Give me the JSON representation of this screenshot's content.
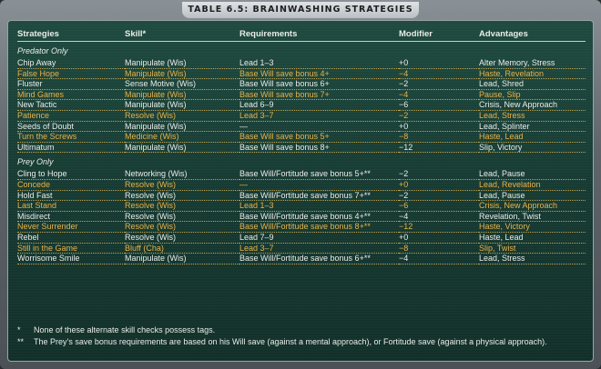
{
  "title": "TABLE 6.5: BRAINWASHING STRATEGIES",
  "headers": [
    "Strategies",
    "Skill*",
    "Requirements",
    "Modifier",
    "Advantages"
  ],
  "sections": [
    {
      "label": "Predator Only",
      "rows": [
        {
          "strategy": "Chip Away",
          "skill": "Manipulate (Wis)",
          "requirements": "Lead 1–3",
          "modifier": "+0",
          "advantages": "Alter Memory, Stress",
          "alt": false
        },
        {
          "strategy": "False Hope",
          "skill": "Manipulate (Wis)",
          "requirements": "Base Will save bonus 4+",
          "modifier": "−4",
          "advantages": "Haste, Revelation",
          "alt": true
        },
        {
          "strategy": "Fluster",
          "skill": "Sense Motive (Wis)",
          "requirements": "Base Will save bonus 6+",
          "modifier": "−2",
          "advantages": "Lead, Shred",
          "alt": false
        },
        {
          "strategy": "Mind Games",
          "skill": "Manipulate (Wis)",
          "requirements": "Base Will save bonus 7+",
          "modifier": "−4",
          "advantages": "Pause, Slip",
          "alt": true
        },
        {
          "strategy": "New Tactic",
          "skill": "Manipulate (Wis)",
          "requirements": "Lead 6–9",
          "modifier": "−6",
          "advantages": "Crisis, New Approach",
          "alt": false
        },
        {
          "strategy": "Patience",
          "skill": "Resolve (Wis)",
          "requirements": "Lead 3–7",
          "modifier": "−2",
          "advantages": "Lead, Stress",
          "alt": true
        },
        {
          "strategy": "Seeds of Doubt",
          "skill": "Manipulate (Wis)",
          "requirements": "—",
          "modifier": "+0",
          "advantages": "Lead, Splinter",
          "alt": false
        },
        {
          "strategy": "Turn the Screws",
          "skill": "Medicine (Wis)",
          "requirements": "Base Will save bonus 5+",
          "modifier": "−8",
          "advantages": "Haste, Lead",
          "alt": true
        },
        {
          "strategy": "Ultimatum",
          "skill": "Manipulate (Wis)",
          "requirements": "Base Will save bonus 8+",
          "modifier": "−12",
          "advantages": "Slip, Victory",
          "alt": false
        }
      ]
    },
    {
      "label": "Prey Only",
      "rows": [
        {
          "strategy": "Cling to Hope",
          "skill": "Networking (Wis)",
          "requirements": "Base Will/Fortitude save bonus 5+**",
          "modifier": "−2",
          "advantages": "Lead, Pause",
          "alt": false
        },
        {
          "strategy": "Concede",
          "skill": "Resolve (Wis)",
          "requirements": "—",
          "modifier": "+0",
          "advantages": "Lead, Revelation",
          "alt": true
        },
        {
          "strategy": "Hold Fast",
          "skill": "Resolve (Wis)",
          "requirements": "Base Will/Fortitude save bonus 7+**",
          "modifier": "−2",
          "advantages": "Lead, Pause",
          "alt": false
        },
        {
          "strategy": "Last Stand",
          "skill": "Resolve (Wis)",
          "requirements": "Lead 1–3",
          "modifier": "−6",
          "advantages": "Crisis, New Approach",
          "alt": true
        },
        {
          "strategy": "Misdirect",
          "skill": "Resolve (Wis)",
          "requirements": "Base Will/Fortitude save bonus 4+**",
          "modifier": "−4",
          "advantages": "Revelation, Twist",
          "alt": false
        },
        {
          "strategy": "Never Surrender",
          "skill": "Resolve (Wis)",
          "requirements": "Base Will/Fortitude save bonus 8+**",
          "modifier": "−12",
          "advantages": "Haste, Victory",
          "alt": true
        },
        {
          "strategy": "Rebel",
          "skill": "Resolve (Wis)",
          "requirements": "Lead 7–9",
          "modifier": "+0",
          "advantages": "Haste, Lead",
          "alt": false
        },
        {
          "strategy": "Still in the Game",
          "skill": "Bluff (Cha)",
          "requirements": "Lead 3–7",
          "modifier": "−8",
          "advantages": "Slip, Twist",
          "alt": true
        },
        {
          "strategy": "Worrisome Smile",
          "skill": "Manipulate (Wis)",
          "requirements": "Base Will/Fortitude save bonus 6+**",
          "modifier": "−4",
          "advantages": "Lead, Stress",
          "alt": false
        }
      ]
    }
  ],
  "footnotes": [
    {
      "mark": "*",
      "text": "None of these alternate skill checks possess tags."
    },
    {
      "mark": "**",
      "text": "The Prey’s save bonus requirements are based on his Will save (against a mental approach), or Fortitude save (against a physical approach)."
    }
  ],
  "colors": {
    "normal_text": "#e9ece9",
    "alt_text": "#e8b24a",
    "panel": "#1f4a3f"
  }
}
